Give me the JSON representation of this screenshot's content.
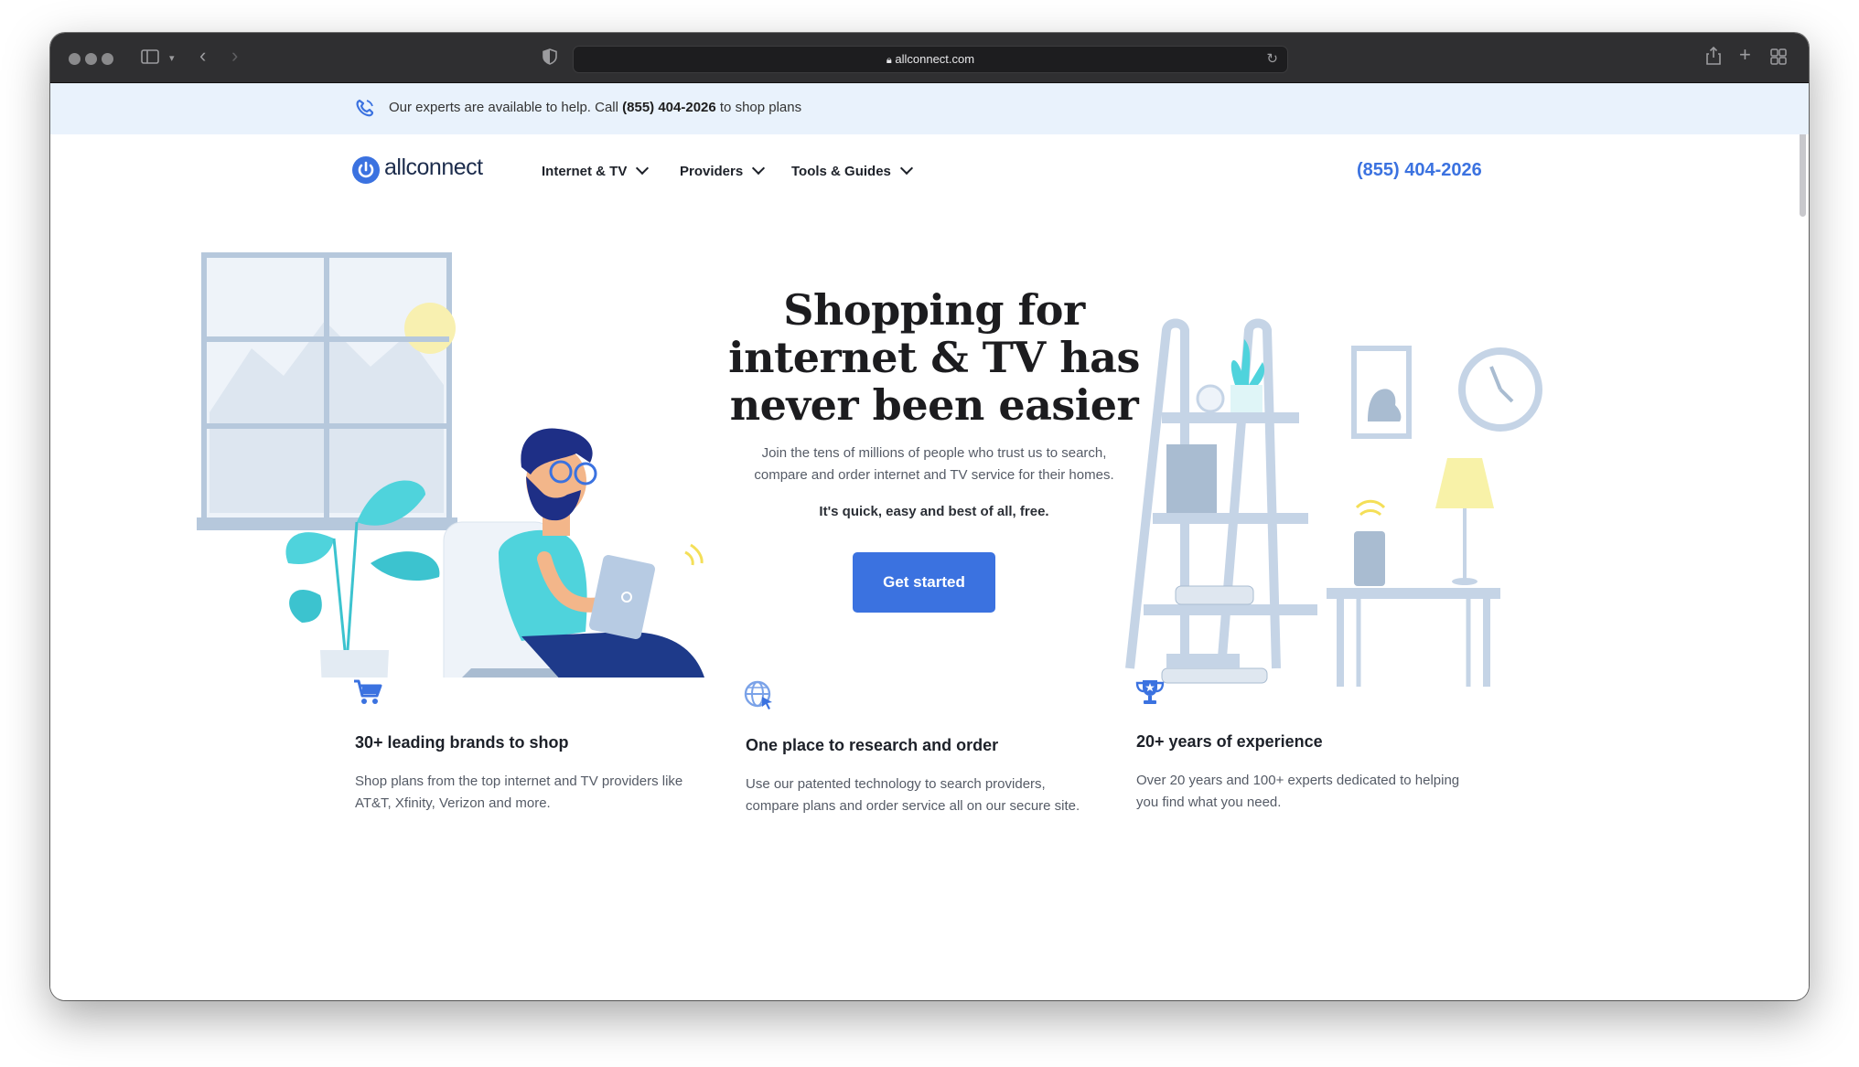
{
  "browser": {
    "url": "allconnect.com"
  },
  "topbar": {
    "text_before": "Our experts are available to help. Call",
    "phone": "(855) 404-2026",
    "text_after": "to shop plans"
  },
  "nav": {
    "logo": "allconnect",
    "items": [
      {
        "label": "Internet & TV"
      },
      {
        "label": "Providers"
      },
      {
        "label": "Tools & Guides"
      }
    ],
    "phone": "(855) 404-2026"
  },
  "hero": {
    "title_line1": "Shopping for",
    "title_line2": "internet & TV has",
    "title_line3": "never been easier",
    "subtitle_line1": "Join the tens of millions of people who trust us to search,",
    "subtitle_line2": "compare and order internet and TV service for their homes.",
    "strong": "It's quick, easy and best of all, free.",
    "cta": "Get started"
  },
  "features": [
    {
      "icon": "cart-icon",
      "title": "30+ leading brands to shop",
      "desc_line1": "Shop plans from the top internet and TV providers like",
      "desc_line2": "AT&T, Xfinity, Verizon and more."
    },
    {
      "icon": "globe-icon",
      "title": "One place to research and order",
      "desc_line1": "Use our patented technology to search providers,",
      "desc_line2": "compare plans and order service all on our secure site."
    },
    {
      "icon": "trophy-icon",
      "title": "20+ years of experience",
      "desc_line1": "Over 20 years and 100+ experts dedicated to helping",
      "desc_line2": "you find what you need."
    }
  ],
  "colors": {
    "brand_blue": "#3b72e0",
    "topbar_bg": "#e9f2fc",
    "titlebar_bg": "#2f2f31"
  }
}
